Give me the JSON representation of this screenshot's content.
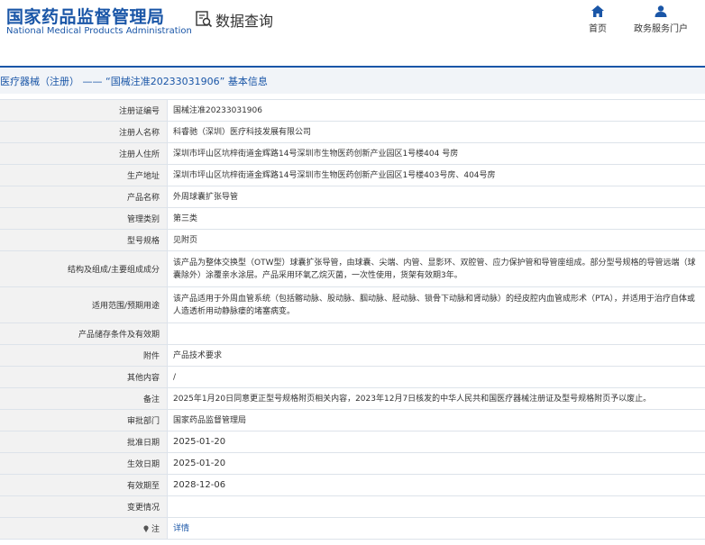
{
  "header": {
    "brand_cn": "国家药品监督管理局",
    "brand_en": "National Medical Products Administration",
    "query_title": "数据查询",
    "nav": [
      {
        "label": "首页",
        "icon": "home-icon"
      },
      {
        "label": "政务服务门户",
        "icon": "user-icon"
      }
    ]
  },
  "section": {
    "title": "医疗器械（注册） —— “国械注准20233031906” 基本信息"
  },
  "colors": {
    "brand_blue": "#1a56a7",
    "label_bg": "#f2f2f2",
    "border": "#dde3ea"
  },
  "rows": [
    {
      "label": "注册证编号",
      "value": "国械注准20233031906"
    },
    {
      "label": "注册人名称",
      "value": "科睿驰（深圳）医疗科技发展有限公司"
    },
    {
      "label": "注册人住所",
      "value": "深圳市坪山区坑梓街道金辉路14号深圳市生物医药创新产业园区1号楼404 号房"
    },
    {
      "label": "生产地址",
      "value": "深圳市坪山区坑梓街道金辉路14号深圳市生物医药创新产业园区1号楼403号房、404号房"
    },
    {
      "label": "产品名称",
      "value": "外周球囊扩张导管"
    },
    {
      "label": "管理类别",
      "value": "第三类"
    },
    {
      "label": "型号规格",
      "value": "见附页"
    },
    {
      "label": "结构及组成/主要组成成分",
      "value": "该产品为整体交换型（OTW型）球囊扩张导管，由球囊、尖端、内管、显影环、双腔管、应力保护管和导管座组成。部分型号规格的导管远端（球囊除外）涂覆亲水涂层。产品采用环氧乙烷灭菌，一次性使用，货架有效期3年。"
    },
    {
      "label": "适用范围/预期用途",
      "value": "该产品适用于外周血管系统（包括髂动脉、股动脉、腘动脉、胫动脉、锁骨下动脉和肾动脉）的经皮腔内血管成形术（PTA），并适用于治疗自体或人造透析用动静脉瘘的堵塞病变。"
    },
    {
      "label": "产品储存条件及有效期",
      "value": ""
    },
    {
      "label": "附件",
      "value": "产品技术要求"
    },
    {
      "label": "其他内容",
      "value": "/"
    },
    {
      "label": "备注",
      "value": "2025年1月20日同意更正型号规格附页相关内容，2023年12月7日核发的中华人民共和国医疗器械注册证及型号规格附页予以废止。"
    },
    {
      "label": "审批部门",
      "value": "国家药品监督管理局"
    },
    {
      "label": "批准日期",
      "value": "2025-01-20"
    },
    {
      "label": "生效日期",
      "value": "2025-01-20"
    },
    {
      "label": "有效期至",
      "value": "2028-12-06"
    },
    {
      "label": "变更情况",
      "value": ""
    },
    {
      "label": "注",
      "value": "详情"
    }
  ]
}
